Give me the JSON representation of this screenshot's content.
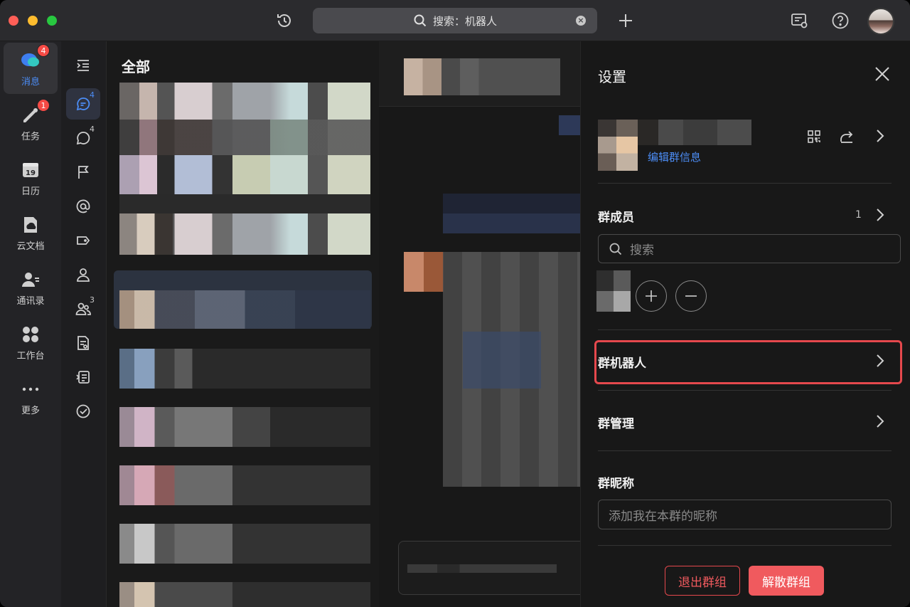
{
  "titlebar": {
    "search_text": "搜索：机器人",
    "icons": [
      "history-icon",
      "search-icon",
      "clear-icon",
      "plus-icon",
      "notice-icon",
      "help-icon",
      "user-avatar"
    ]
  },
  "rail": {
    "items": [
      {
        "label": "消息",
        "icon": "message-icon",
        "badge": "4",
        "active": true
      },
      {
        "label": "任务",
        "icon": "task-icon",
        "badge": "1"
      },
      {
        "label": "日历",
        "icon": "calendar-icon",
        "icon_text": "19"
      },
      {
        "label": "云文档",
        "icon": "cloud-doc-icon"
      },
      {
        "label": "通讯录",
        "icon": "contacts-icon"
      },
      {
        "label": "工作台",
        "icon": "workbench-icon"
      },
      {
        "label": "更多",
        "icon": "more-icon"
      }
    ]
  },
  "rail2": {
    "items": [
      {
        "icon": "expand-icon"
      },
      {
        "icon": "chat-icon",
        "sup": "4",
        "active": true
      },
      {
        "icon": "unread-icon",
        "sup": "4"
      },
      {
        "icon": "flag-icon"
      },
      {
        "icon": "at-icon"
      },
      {
        "icon": "tag-icon"
      },
      {
        "icon": "single-chat-icon"
      },
      {
        "icon": "group-icon",
        "sup": "3"
      },
      {
        "icon": "doc-icon"
      },
      {
        "icon": "topic-icon"
      },
      {
        "icon": "done-icon"
      }
    ]
  },
  "chatlist": {
    "title": "全部"
  },
  "settings": {
    "title": "设置",
    "edit_group_info": "编辑群信息",
    "members_label": "群成员",
    "members_count": "1",
    "search_placeholder": "搜索",
    "bots_label": "群机器人",
    "manage_label": "群管理",
    "nickname_label": "群昵称",
    "nickname_placeholder": "添加我在本群的昵称",
    "exit_label": "退出群组",
    "dissolve_label": "解散群组"
  },
  "colors": {
    "accent": "#4c8df6",
    "danger": "#f05a5e",
    "badge": "#f54a45"
  }
}
